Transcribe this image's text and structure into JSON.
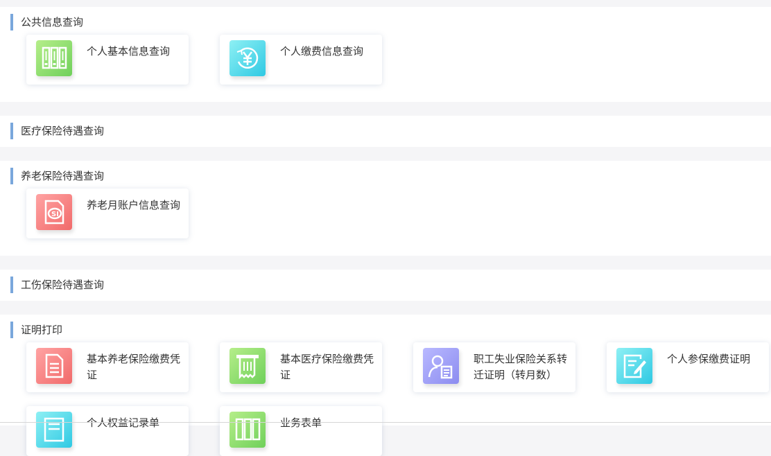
{
  "sections": {
    "public": {
      "title": "公共信息查询",
      "items": [
        {
          "label": "个人基本信息查询",
          "icon": "cabinet-icon",
          "color": "#8ade6e"
        },
        {
          "label": "个人缴费信息查询",
          "icon": "yen-icon",
          "color": "#4fd4ea"
        }
      ]
    },
    "medical": {
      "title": "医疗保险待遇查询"
    },
    "pension": {
      "title": "养老保险待遇查询",
      "items": [
        {
          "label": "养老月账户信息查询",
          "icon": "si-document-icon",
          "color": "#f58080"
        }
      ]
    },
    "injury": {
      "title": "工伤保险待遇查询"
    },
    "certificate": {
      "title": "证明打印",
      "items": [
        {
          "label": "基本养老保险缴费凭证",
          "icon": "document-icon",
          "color": "#f58080"
        },
        {
          "label": "基本医疗保险缴费凭证",
          "icon": "receipt-icon",
          "color": "#8ade6e"
        },
        {
          "label": "职工失业保险关系转迁证明（转月数）",
          "icon": "user-document-icon",
          "color": "#9d9df5"
        },
        {
          "label": "个人参保缴费证明",
          "icon": "edit-icon",
          "color": "#4fd4ea"
        },
        {
          "label": "个人权益记录单",
          "icon": "record-icon",
          "color": "#4fd4ea"
        },
        {
          "label": "业务表单",
          "icon": "form-icon",
          "color": "#8ade6e"
        }
      ]
    }
  }
}
